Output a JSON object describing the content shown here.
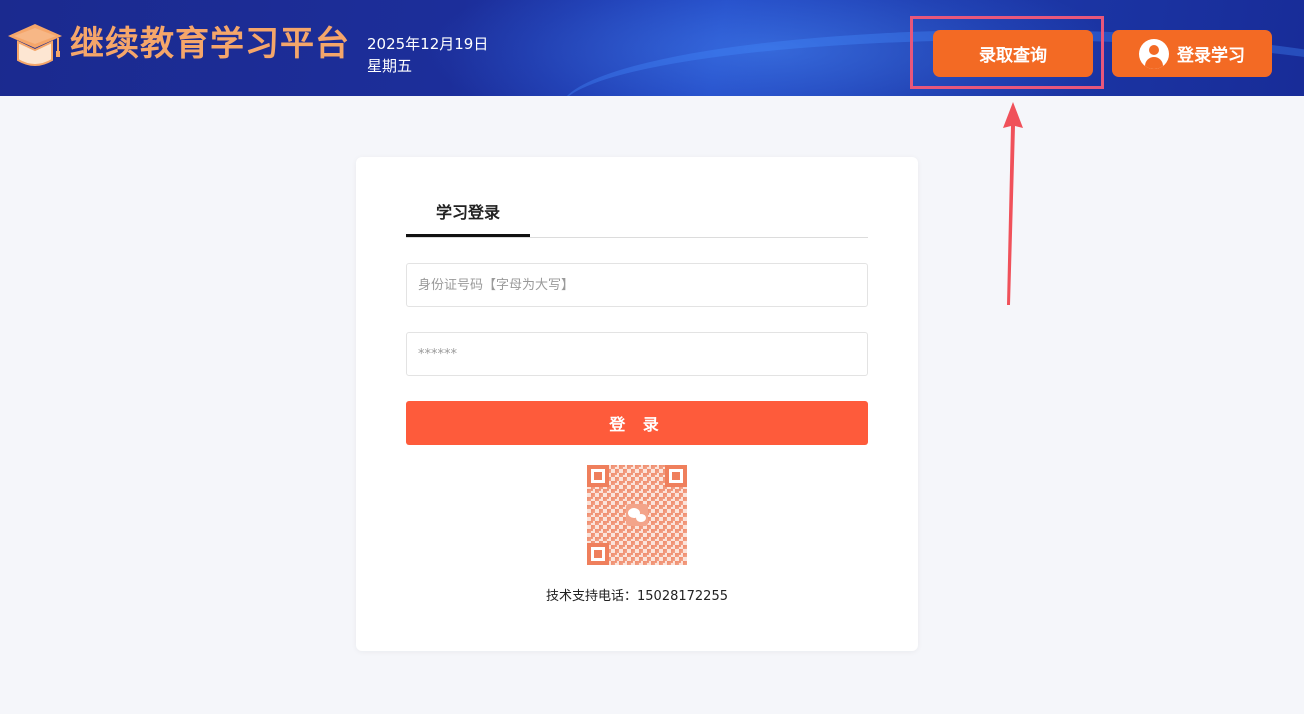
{
  "header": {
    "brand_title": "继续教育学习平台",
    "date_line": "2025年12月19日",
    "weekday": "星期五",
    "query_button_label": "录取查询",
    "login_button_label": "登录学习"
  },
  "login_card": {
    "tab_label": "学习登录",
    "id_placeholder": "身份证号码【字母为大写】",
    "password_placeholder": "******",
    "submit_label": "登 录",
    "support_text": "技术支持电话：15028172255"
  },
  "colors": {
    "header_bg": "#1c2e9a",
    "accent_orange": "#f36a24",
    "submit_red": "#fe5b3b",
    "brand_text": "#f5a66a",
    "highlight": "#e8577b"
  },
  "icons": [
    "graduation-cap-icon",
    "user-avatar-icon",
    "qr-code-icon",
    "wechat-icon"
  ]
}
